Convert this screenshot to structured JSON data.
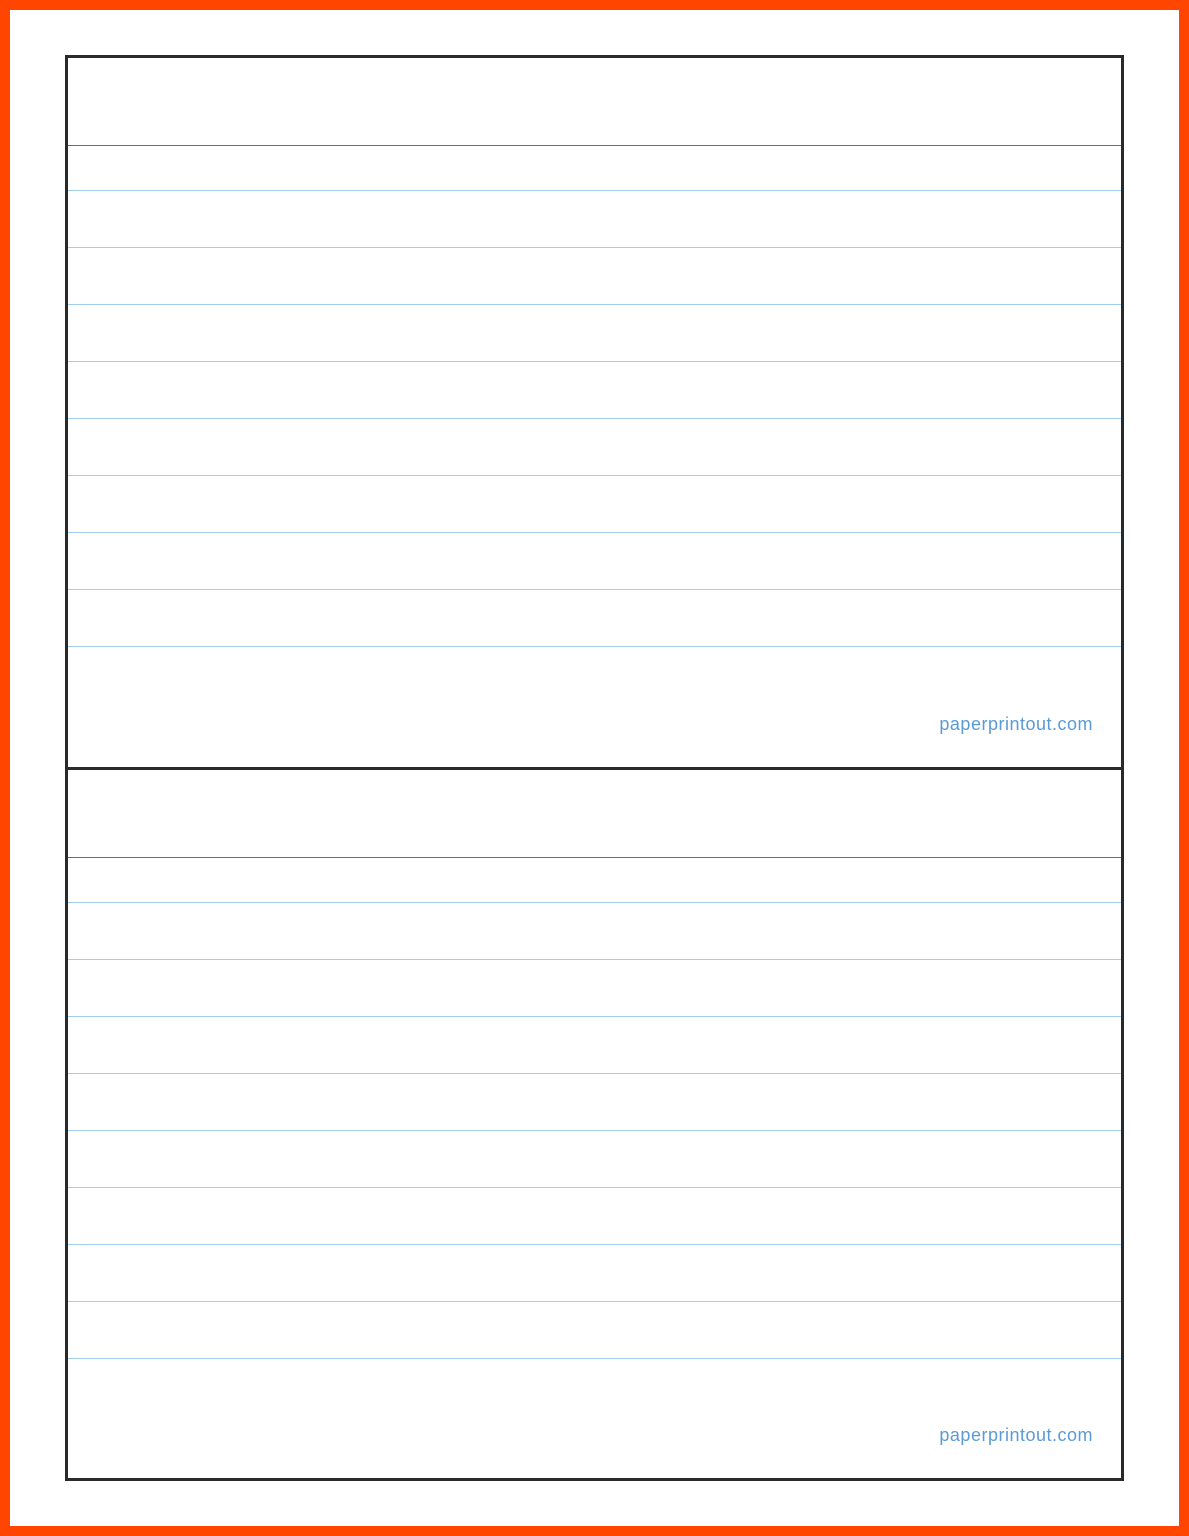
{
  "cards": [
    {
      "watermark": "paperprintout.com"
    },
    {
      "watermark": "paperprintout.com"
    }
  ]
}
